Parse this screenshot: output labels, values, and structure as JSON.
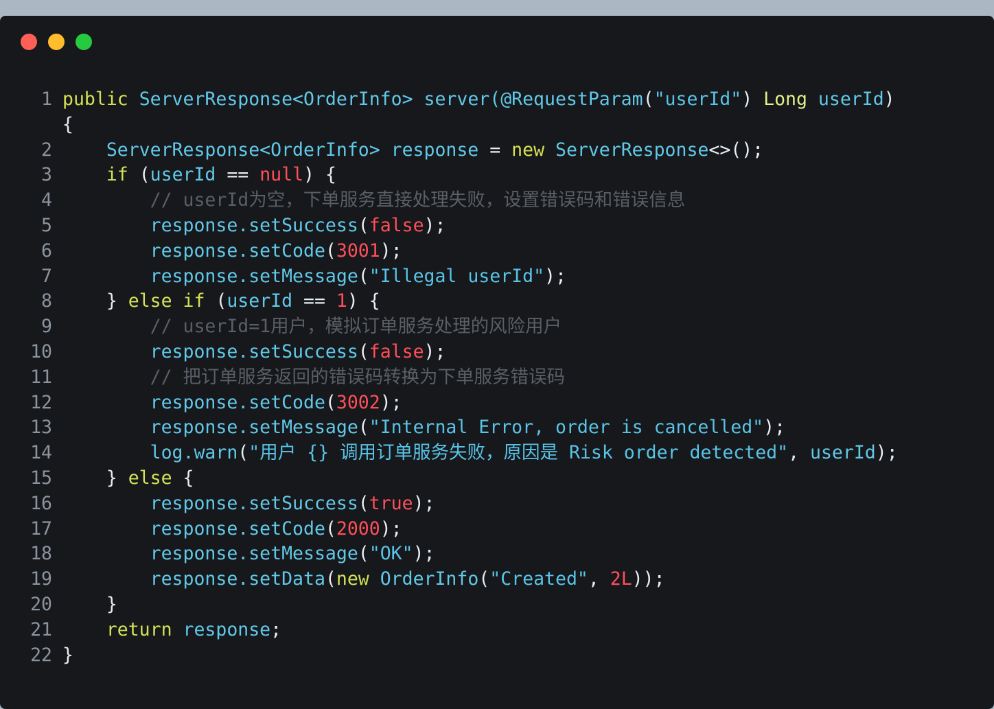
{
  "window": {
    "controls": [
      "close",
      "minimize",
      "zoom"
    ],
    "colors": {
      "close": "#ff5f56",
      "minimize": "#ffbd2e",
      "zoom": "#27c93f"
    }
  },
  "code": {
    "language": "java",
    "lines": [
      {
        "n": "1",
        "tokens": [
          [
            "kw",
            "public"
          ],
          [
            "t",
            " ServerResponse<OrderInfo> server("
          ],
          [
            "t",
            "@RequestParam"
          ],
          [
            "p",
            "("
          ],
          [
            "s",
            "\"userId\""
          ],
          [
            "p",
            ")"
          ],
          [
            "typ",
            " Long"
          ],
          [
            "t",
            " userId"
          ],
          [
            "p",
            ")"
          ]
        ]
      },
      {
        "n": "",
        "tokens": [
          [
            "p",
            "{"
          ]
        ]
      },
      {
        "n": "2",
        "tokens": [
          [
            "t",
            "    ServerResponse<OrderInfo> response "
          ],
          [
            "p",
            "="
          ],
          [
            "kw",
            " new"
          ],
          [
            "t",
            " ServerResponse"
          ],
          [
            "p",
            "<>();"
          ]
        ]
      },
      {
        "n": "3",
        "tokens": [
          [
            "kw",
            "    if"
          ],
          [
            "p",
            " ("
          ],
          [
            "t",
            "userId "
          ],
          [
            "p",
            "=="
          ],
          [
            "num",
            " null"
          ],
          [
            "p",
            ") {"
          ]
        ]
      },
      {
        "n": "4",
        "tokens": [
          [
            "c",
            "        // userId为空，下单服务直接处理失败，设置错误码和错误信息"
          ]
        ]
      },
      {
        "n": "5",
        "tokens": [
          [
            "t",
            "        response.setSuccess"
          ],
          [
            "p",
            "("
          ],
          [
            "num",
            "false"
          ],
          [
            "p",
            ");"
          ]
        ]
      },
      {
        "n": "6",
        "tokens": [
          [
            "t",
            "        response.setCode"
          ],
          [
            "p",
            "("
          ],
          [
            "num",
            "3001"
          ],
          [
            "p",
            ");"
          ]
        ]
      },
      {
        "n": "7",
        "tokens": [
          [
            "t",
            "        response.setMessage"
          ],
          [
            "p",
            "("
          ],
          [
            "s",
            "\"Illegal userId\""
          ],
          [
            "p",
            ");"
          ]
        ]
      },
      {
        "n": "8",
        "tokens": [
          [
            "p",
            "    } "
          ],
          [
            "kw",
            "else if"
          ],
          [
            "p",
            " ("
          ],
          [
            "t",
            "userId "
          ],
          [
            "p",
            "=="
          ],
          [
            "num",
            " 1"
          ],
          [
            "p",
            ") {"
          ]
        ]
      },
      {
        "n": "9",
        "tokens": [
          [
            "c",
            "        // userId=1用户，模拟订单服务处理的风险用户"
          ]
        ]
      },
      {
        "n": "10",
        "tokens": [
          [
            "t",
            "        response.setSuccess"
          ],
          [
            "p",
            "("
          ],
          [
            "num",
            "false"
          ],
          [
            "p",
            ");"
          ]
        ]
      },
      {
        "n": "11",
        "tokens": [
          [
            "c",
            "        // 把订单服务返回的错误码转换为下单服务错误码"
          ]
        ]
      },
      {
        "n": "12",
        "tokens": [
          [
            "t",
            "        response.setCode"
          ],
          [
            "p",
            "("
          ],
          [
            "num",
            "3002"
          ],
          [
            "p",
            ");"
          ]
        ]
      },
      {
        "n": "13",
        "tokens": [
          [
            "t",
            "        response.setMessage"
          ],
          [
            "p",
            "("
          ],
          [
            "s",
            "\"Internal Error, order is cancelled\""
          ],
          [
            "p",
            ");"
          ]
        ]
      },
      {
        "n": "14",
        "tokens": [
          [
            "t",
            "        log.warn"
          ],
          [
            "p",
            "("
          ],
          [
            "s",
            "\"用户 {} 调用订单服务失败，原因是 Risk order detected\""
          ],
          [
            "p",
            ", "
          ],
          [
            "t",
            "userId"
          ],
          [
            "p",
            ");"
          ]
        ]
      },
      {
        "n": "15",
        "tokens": [
          [
            "p",
            "    } "
          ],
          [
            "kw",
            "else"
          ],
          [
            "p",
            " {"
          ]
        ]
      },
      {
        "n": "16",
        "tokens": [
          [
            "t",
            "        response.setSuccess"
          ],
          [
            "p",
            "("
          ],
          [
            "num",
            "true"
          ],
          [
            "p",
            ");"
          ]
        ]
      },
      {
        "n": "17",
        "tokens": [
          [
            "t",
            "        response.setCode"
          ],
          [
            "p",
            "("
          ],
          [
            "num",
            "2000"
          ],
          [
            "p",
            ");"
          ]
        ]
      },
      {
        "n": "18",
        "tokens": [
          [
            "t",
            "        response.setMessage"
          ],
          [
            "p",
            "("
          ],
          [
            "s",
            "\"OK\""
          ],
          [
            "p",
            ");"
          ]
        ]
      },
      {
        "n": "19",
        "tokens": [
          [
            "t",
            "        response.setData"
          ],
          [
            "p",
            "("
          ],
          [
            "kw",
            "new"
          ],
          [
            "t",
            " OrderInfo"
          ],
          [
            "p",
            "("
          ],
          [
            "s",
            "\"Created\""
          ],
          [
            "p",
            ", "
          ],
          [
            "num",
            "2L"
          ],
          [
            "p",
            "));"
          ]
        ]
      },
      {
        "n": "20",
        "tokens": [
          [
            "p",
            "    }"
          ]
        ]
      },
      {
        "n": "21",
        "tokens": [
          [
            "kw",
            "    return"
          ],
          [
            "t",
            " response"
          ],
          [
            "p",
            ";"
          ]
        ]
      },
      {
        "n": "22",
        "tokens": [
          [
            "p",
            "}"
          ]
        ]
      }
    ]
  }
}
